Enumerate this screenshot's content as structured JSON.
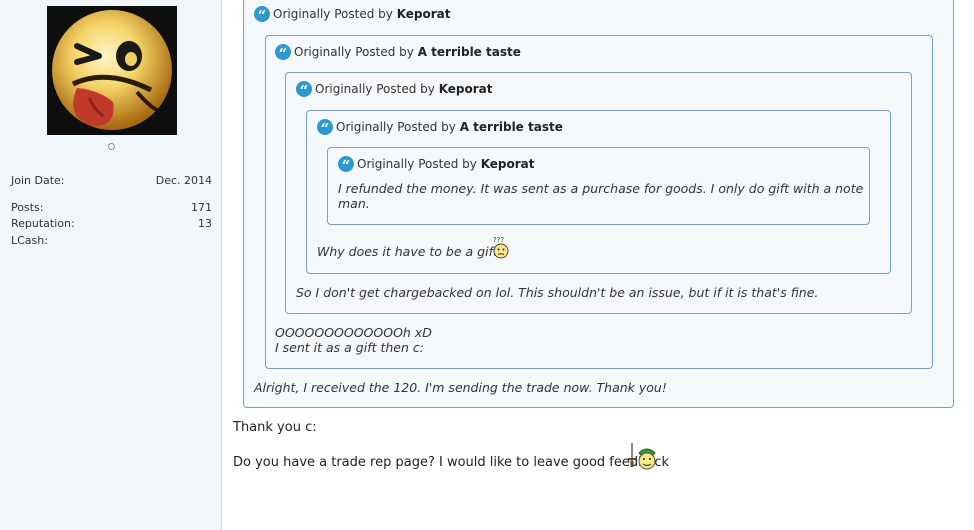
{
  "user": {
    "join_date_label": "Join Date:",
    "join_date": "Dec. 2014",
    "posts_label": "Posts:",
    "posts": "171",
    "reputation_label": "Reputation:",
    "reputation": "13",
    "lcash_label": "LCash:",
    "lcash": ""
  },
  "quotes": {
    "prefix": "Originally Posted by",
    "q1_author": "Keporat",
    "q2_author": "A terrible taste",
    "q3_author": "Keporat",
    "q4_author": "A terrible taste",
    "q5_author": "Keporat",
    "q5_text_line1": "I refunded the money. It was sent as a purchase for goods. I only do gift with a note",
    "q5_text_line2": "man.",
    "q4_text": "Why does it have to be a gift?",
    "q3_text": "So I don't get chargebacked on lol. This shouldn't be an issue, but if it is that's fine.",
    "q2_text_line1": "OOOOOOOOOOOOOh xD",
    "q2_text_line2": "I sent it as a gift then c:",
    "q1_text": "Alright, I received the 120. I'm sending the trade now. Thank you!"
  },
  "post": {
    "line1": "Thank you c:",
    "line2": "Do you have a trade rep page? I would like to leave good feedback"
  },
  "colors": {
    "panel_bg": "#f1f6fb",
    "quote_border": "#7a9fc4",
    "quote_bg": "#f5f8fb",
    "quote_icon": "#2f99cf"
  }
}
